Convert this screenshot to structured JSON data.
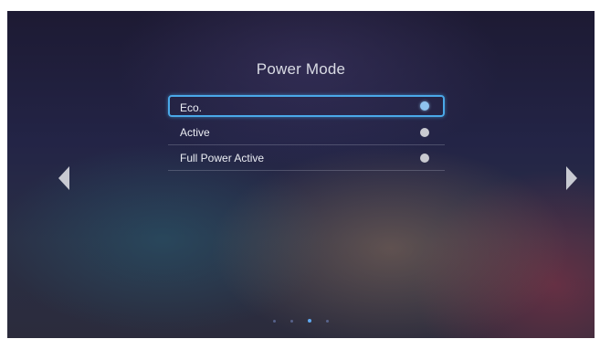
{
  "screen": {
    "title": "Power Mode"
  },
  "menu": {
    "items": [
      {
        "label": "Eco.",
        "selected": true
      },
      {
        "label": "Active",
        "selected": false
      },
      {
        "label": "Full Power Active",
        "selected": false
      }
    ]
  },
  "navigation": {
    "left_icon": "triangle-left",
    "right_icon": "triangle-right"
  },
  "pagination": {
    "total_pages": 4,
    "current_page": 3
  },
  "colors": {
    "focus": "#4aa8e8",
    "text": "#eceef4"
  }
}
